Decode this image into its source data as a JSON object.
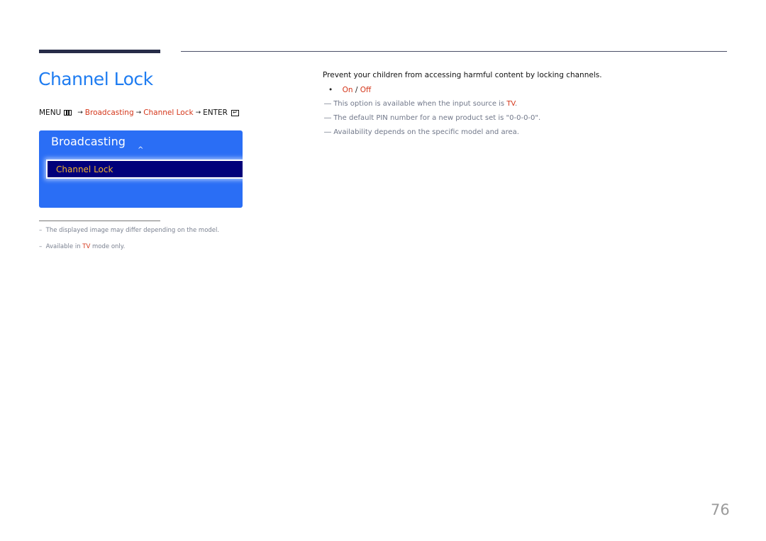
{
  "page": {
    "title": "Channel Lock",
    "page_number": "76"
  },
  "menu_path": {
    "menu_label": "MENU",
    "menu_icon": "menu-icon",
    "step1": "Broadcasting",
    "step2": "Channel Lock",
    "enter_label": "ENTER",
    "enter_icon": "enter-icon",
    "arrow": "→"
  },
  "osd": {
    "title": "Broadcasting",
    "up_arrow": "^",
    "selected_item": "Channel Lock"
  },
  "footnotes": [
    {
      "dash": "–",
      "text": "The displayed image may differ depending on the model."
    },
    {
      "dash": "–",
      "prefix": "Available in ",
      "highlight": "TV",
      "suffix": " mode only."
    }
  ],
  "description": "Prevent your children from accessing harmful content by locking channels.",
  "options": {
    "bullet": "•",
    "on": "On",
    "separator": " / ",
    "off": "Off"
  },
  "notes": [
    {
      "dash": "―",
      "prefix": "This option is available when the input source is ",
      "highlight": "TV",
      "suffix": "."
    },
    {
      "dash": "―",
      "text": "The default PIN number for a new product set is \"0-0-0-0\"."
    },
    {
      "dash": "―",
      "text": "Availability depends on the specific model and area."
    }
  ],
  "colors": {
    "title_blue": "#1e7cf1",
    "highlight_red": "#d4361a",
    "osd_blue": "#2a6ef5",
    "osd_selected_bg": "#01007a",
    "osd_selected_text": "#f3b42d"
  }
}
